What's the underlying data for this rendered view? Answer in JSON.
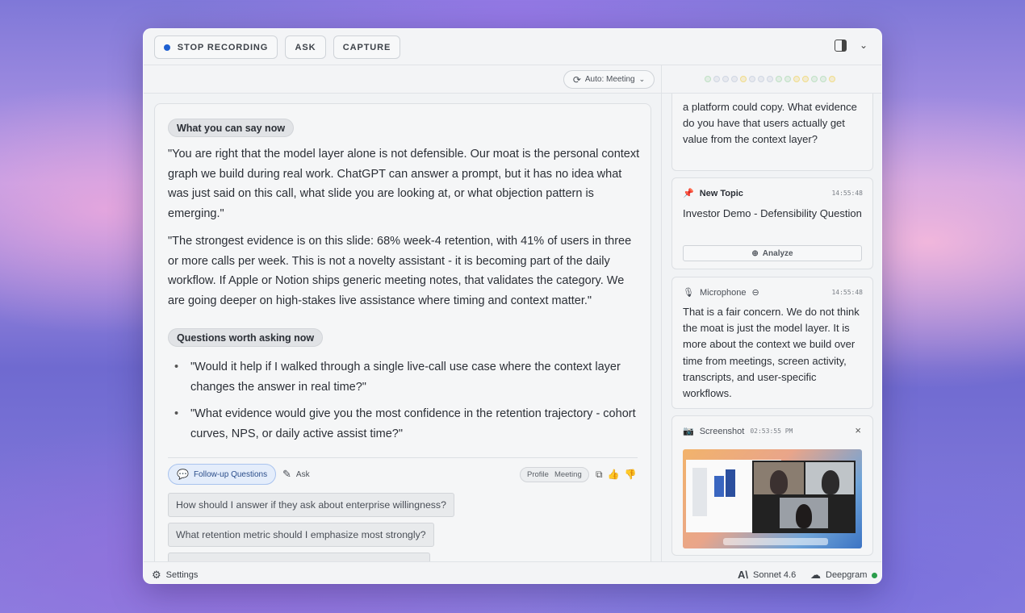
{
  "toolbar": {
    "stop_recording": "STOP RECORDING",
    "ask": "ASK",
    "capture": "CAPTURE"
  },
  "mode": {
    "label": "Auto: Meeting"
  },
  "status_dots": [
    "#bfe0c4",
    "#cfd6e2",
    "#cfd6e2",
    "#cfd6e2",
    "#f0dc8a",
    "#cfd6e2",
    "#cfd6e2",
    "#cfd6e2",
    "#bfe0c4",
    "#bfe0c4",
    "#f0dc8a",
    "#f0dc8a",
    "#bfe0c4",
    "#bfe0c4",
    "#f0dc8a"
  ],
  "main": {
    "section1_title": "What you can say now",
    "para1": "\"You are right that the model layer alone is not defensible. Our moat is the personal context graph we build during real work. ChatGPT can answer a prompt, but it has no idea what was just said on this call, what slide you are looking at, or what objection pattern is emerging.\"",
    "para2": "\"The strongest evidence is on this slide: 68% week-4 retention, with 41% of users in three or more calls per week. This is not a novelty assistant - it is becoming part of the daily workflow. If Apple or Notion ships generic meeting notes, that validates the category. We are going deeper on high-stakes live assistance where timing and context matter.\"",
    "section2_title": "Questions worth asking now",
    "bullets": [
      "\"Would it help if I walked through a single live-call use case where the context layer changes the answer in real time?\"",
      "\"What evidence would give you the most confidence in the retention trajectory - cohort curves, NPS, or daily active assist time?\""
    ],
    "followup_label": "Follow-up Questions",
    "ask_label": "Ask",
    "profile_label": "Profile",
    "profile_value": "Meeting",
    "suggestions": [
      "How should I answer if they ask about enterprise willingness?",
      "What retention metric should I emphasize most strongly?",
      ""
    ]
  },
  "side": {
    "card0_text": "a platform could copy. What evidence do you have that users actually get value from the context layer?",
    "topic": {
      "header": "New Topic",
      "time": "14:55:48",
      "text": "Investor Demo - Defensibility Question",
      "analyze": "Analyze"
    },
    "mic": {
      "header": "Microphone",
      "time": "14:55:48",
      "text": "That is a fair concern. We do not think the moat is just the model layer. It is more about the context we build over time from meetings, screen activity, transcripts, and user-specific workflows."
    },
    "screenshot": {
      "header": "Screenshot",
      "time": "02:53:55 PM"
    }
  },
  "footer": {
    "settings": "Settings",
    "model": "Sonnet 4.6",
    "transcriber": "Deepgram"
  }
}
